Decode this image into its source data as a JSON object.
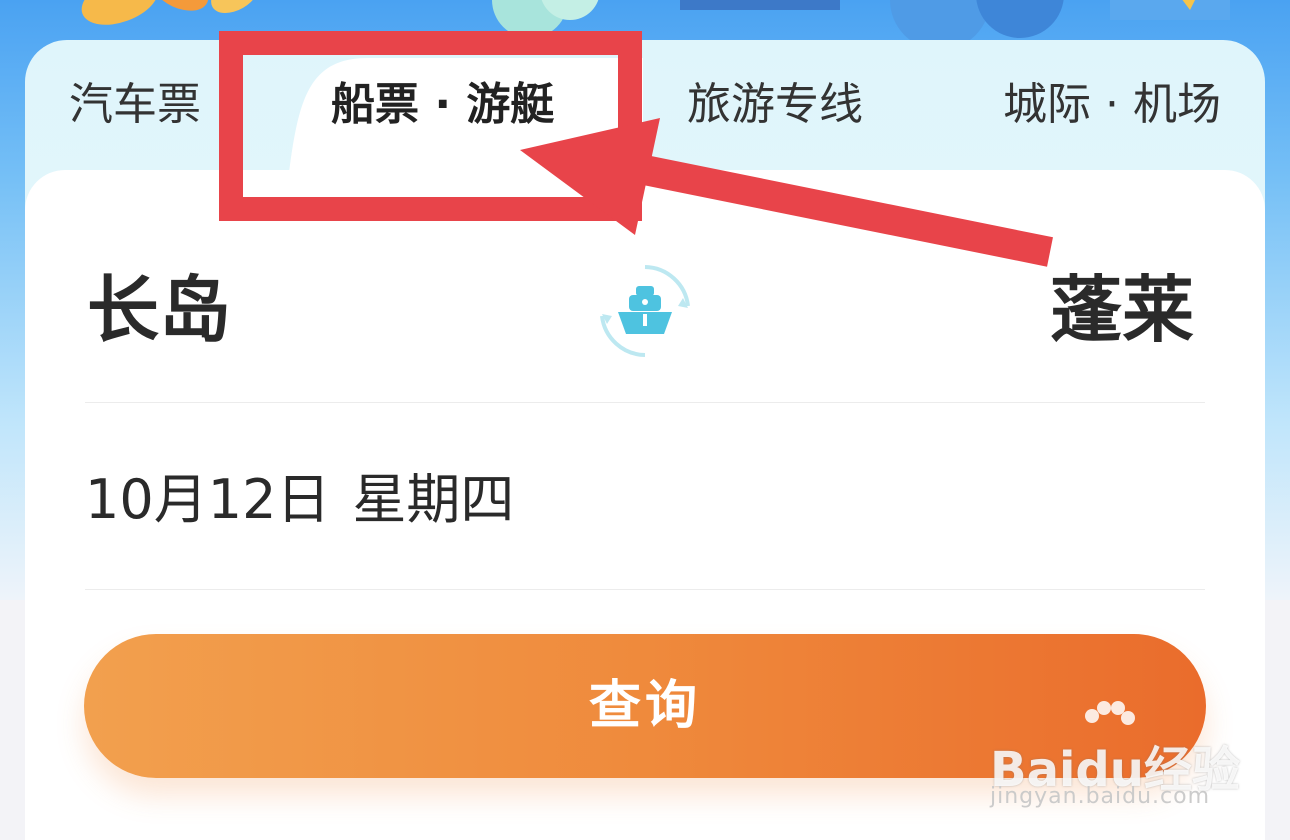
{
  "tabs": [
    {
      "label": "汽车票",
      "active": false
    },
    {
      "label": "船票 · 游艇",
      "active": true
    },
    {
      "label": "旅游专线",
      "active": false
    },
    {
      "label": "城际 · 机场",
      "active": false
    }
  ],
  "route": {
    "from_city": "长岛",
    "to_city": "蓬莱",
    "swap_icon": "ship-swap-icon"
  },
  "date": {
    "date_text": "10月12日",
    "weekday": "星期四"
  },
  "query_button": {
    "label": "查询"
  },
  "annotation": {
    "color": "#e8444a"
  },
  "watermark": {
    "logo": "Baidu经验",
    "url": "jingyan.baidu.com"
  },
  "colors": {
    "accent_start": "#f2a04e",
    "accent_end": "#ea6c2c",
    "icon_teal": "#4ec3e0"
  }
}
